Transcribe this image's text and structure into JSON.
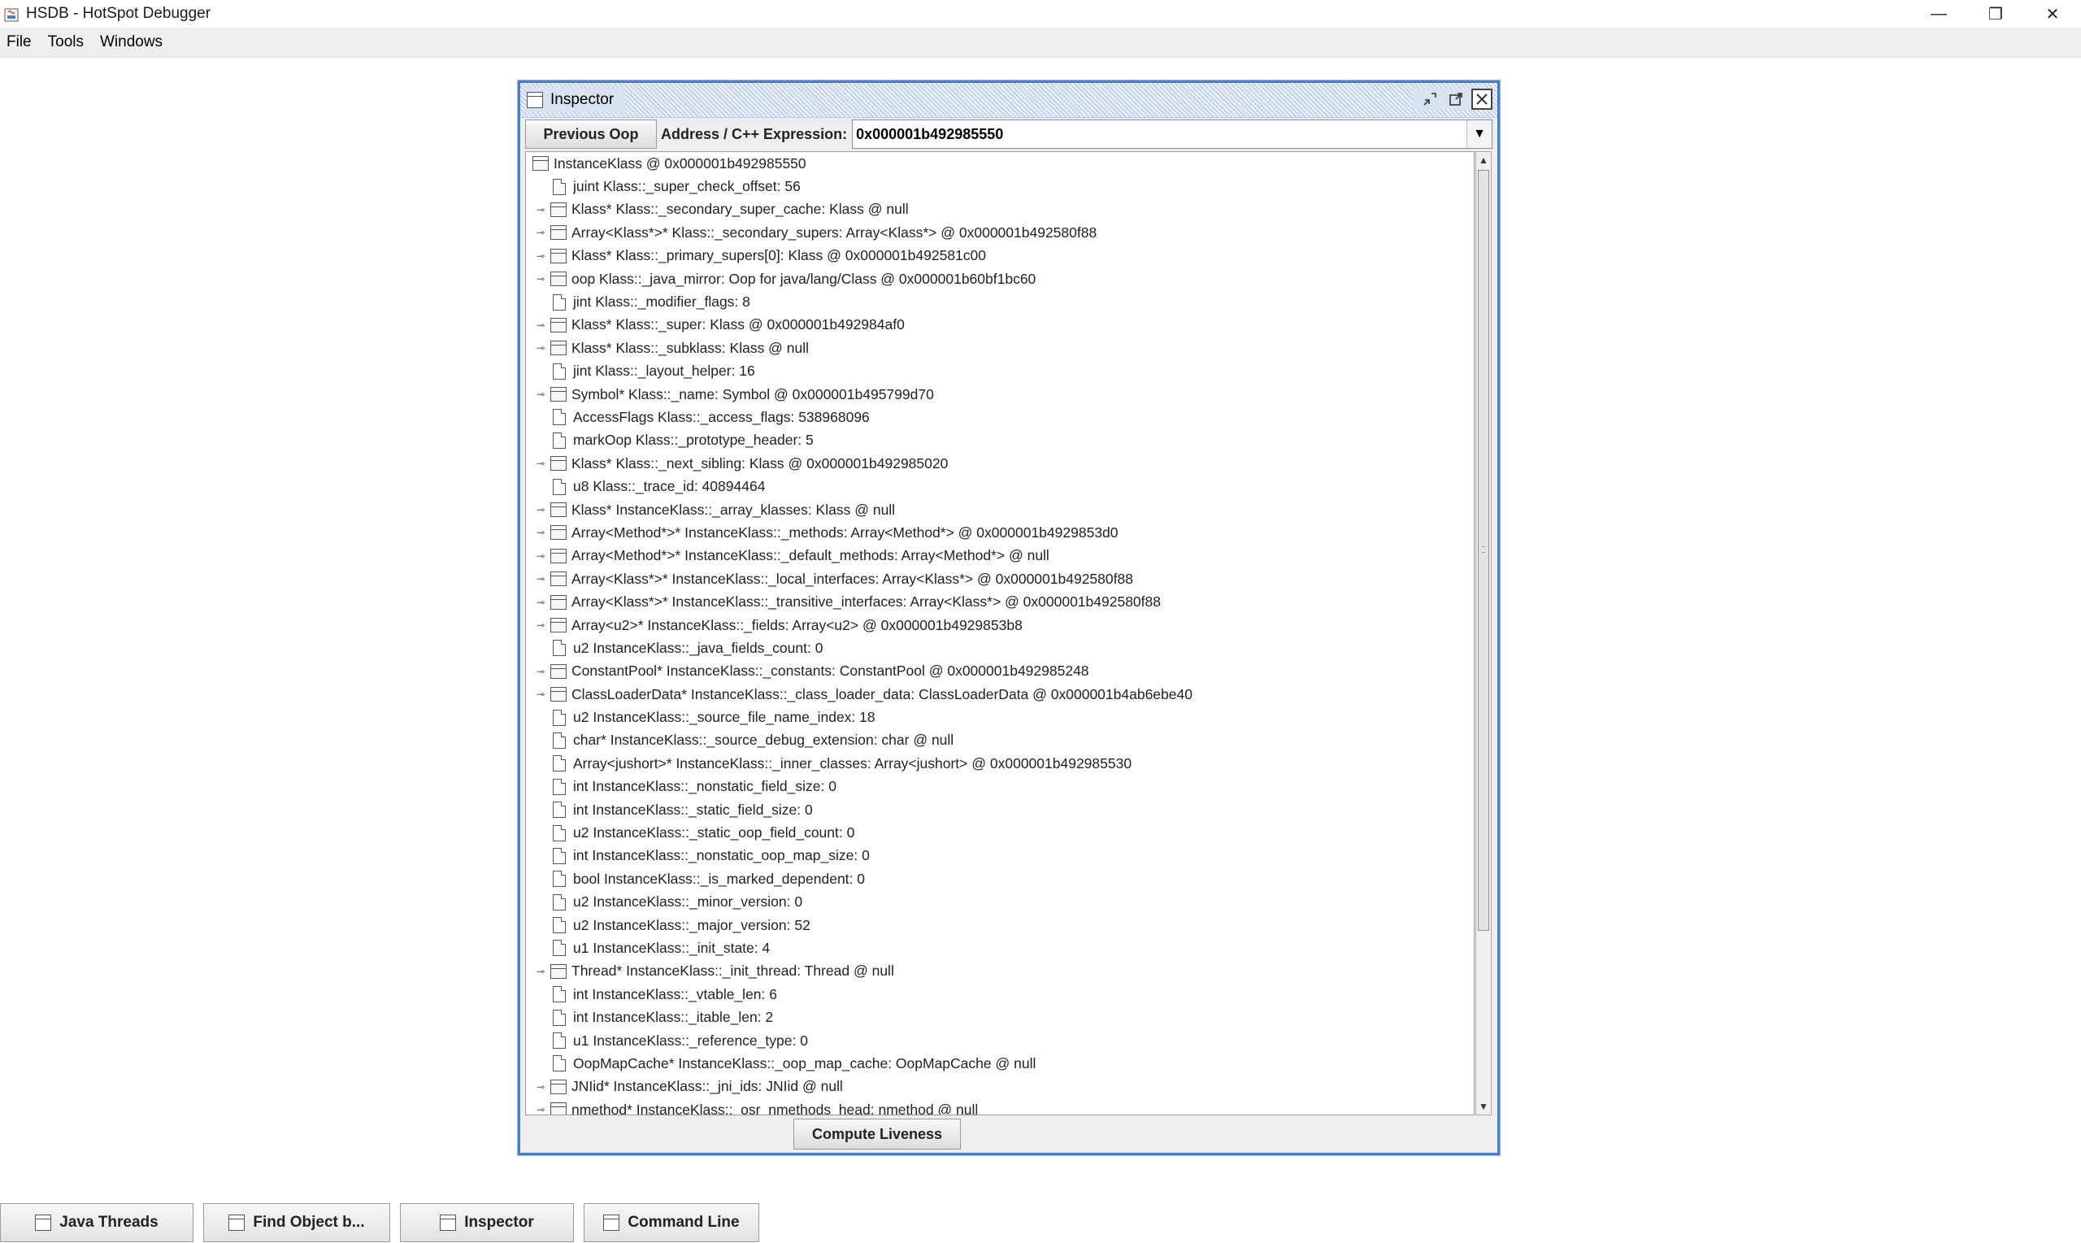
{
  "window": {
    "title": "HSDB - HotSpot Debugger",
    "minimize": "—",
    "restore": "❐",
    "close": "✕"
  },
  "menu": [
    "File",
    "Tools",
    "Windows"
  ],
  "inspector": {
    "title": "Inspector",
    "previous_oop_label": "Previous Oop",
    "address_label": "Address / C++ Expression:",
    "address_value": "0x000001b492985550",
    "compute_liveness_label": "Compute Liveness",
    "root": "InstanceKlass @ 0x000001b492985550",
    "fields": [
      {
        "label": "juint Klass::_super_check_offset: 56",
        "expandable": false
      },
      {
        "label": "Klass* Klass::_secondary_super_cache: Klass @ null",
        "expandable": true
      },
      {
        "label": "Array<Klass*>* Klass::_secondary_supers: Array<Klass*> @ 0x000001b492580f88",
        "expandable": true
      },
      {
        "label": "Klass* Klass::_primary_supers[0]: Klass @ 0x000001b492581c00",
        "expandable": true
      },
      {
        "label": "oop Klass::_java_mirror: Oop for java/lang/Class @ 0x000001b60bf1bc60",
        "expandable": true
      },
      {
        "label": "jint Klass::_modifier_flags: 8",
        "expandable": false
      },
      {
        "label": "Klass* Klass::_super: Klass @ 0x000001b492984af0",
        "expandable": true
      },
      {
        "label": "Klass* Klass::_subklass: Klass @ null",
        "expandable": true
      },
      {
        "label": "jint Klass::_layout_helper: 16",
        "expandable": false
      },
      {
        "label": "Symbol* Klass::_name: Symbol @ 0x000001b495799d70",
        "expandable": true
      },
      {
        "label": "AccessFlags Klass::_access_flags: 538968096",
        "expandable": false
      },
      {
        "label": "markOop Klass::_prototype_header: 5",
        "expandable": false
      },
      {
        "label": "Klass* Klass::_next_sibling: Klass @ 0x000001b492985020",
        "expandable": true
      },
      {
        "label": "u8 Klass::_trace_id: 40894464",
        "expandable": false
      },
      {
        "label": "Klass* InstanceKlass::_array_klasses: Klass @ null",
        "expandable": true
      },
      {
        "label": "Array<Method*>* InstanceKlass::_methods: Array<Method*> @ 0x000001b4929853d0",
        "expandable": true
      },
      {
        "label": "Array<Method*>* InstanceKlass::_default_methods: Array<Method*> @ null",
        "expandable": true
      },
      {
        "label": "Array<Klass*>* InstanceKlass::_local_interfaces: Array<Klass*> @ 0x000001b492580f88",
        "expandable": true
      },
      {
        "label": "Array<Klass*>* InstanceKlass::_transitive_interfaces: Array<Klass*> @ 0x000001b492580f88",
        "expandable": true
      },
      {
        "label": "Array<u2>* InstanceKlass::_fields: Array<u2> @ 0x000001b4929853b8",
        "expandable": true
      },
      {
        "label": "u2 InstanceKlass::_java_fields_count: 0",
        "expandable": false
      },
      {
        "label": "ConstantPool* InstanceKlass::_constants: ConstantPool @ 0x000001b492985248",
        "expandable": true
      },
      {
        "label": "ClassLoaderData* InstanceKlass::_class_loader_data: ClassLoaderData @ 0x000001b4ab6ebe40",
        "expandable": true
      },
      {
        "label": "u2 InstanceKlass::_source_file_name_index: 18",
        "expandable": false
      },
      {
        "label": "char* InstanceKlass::_source_debug_extension: char @ null",
        "expandable": false
      },
      {
        "label": "Array<jushort>* InstanceKlass::_inner_classes: Array<jushort> @ 0x000001b492985530",
        "expandable": false
      },
      {
        "label": "int InstanceKlass::_nonstatic_field_size: 0",
        "expandable": false
      },
      {
        "label": "int InstanceKlass::_static_field_size: 0",
        "expandable": false
      },
      {
        "label": "u2 InstanceKlass::_static_oop_field_count: 0",
        "expandable": false
      },
      {
        "label": "int InstanceKlass::_nonstatic_oop_map_size: 0",
        "expandable": false
      },
      {
        "label": "bool InstanceKlass::_is_marked_dependent: 0",
        "expandable": false
      },
      {
        "label": "u2 InstanceKlass::_minor_version: 0",
        "expandable": false
      },
      {
        "label": "u2 InstanceKlass::_major_version: 52",
        "expandable": false
      },
      {
        "label": "u1 InstanceKlass::_init_state: 4",
        "expandable": false
      },
      {
        "label": "Thread* InstanceKlass::_init_thread: Thread @ null",
        "expandable": true
      },
      {
        "label": "int InstanceKlass::_vtable_len: 6",
        "expandable": false
      },
      {
        "label": "int InstanceKlass::_itable_len: 2",
        "expandable": false
      },
      {
        "label": "u1 InstanceKlass::_reference_type: 0",
        "expandable": false
      },
      {
        "label": "OopMapCache* InstanceKlass::_oop_map_cache: OopMapCache @ null",
        "expandable": false
      },
      {
        "label": "JNIid* InstanceKlass::_jni_ids: JNIid @ null",
        "expandable": true
      },
      {
        "label": "nmethod* InstanceKlass::_osr_nmethods_head: nmethod @ null",
        "expandable": true
      }
    ]
  },
  "taskbar": [
    "Java Threads",
    "Find Object b...",
    "Inspector",
    "Command Line"
  ]
}
